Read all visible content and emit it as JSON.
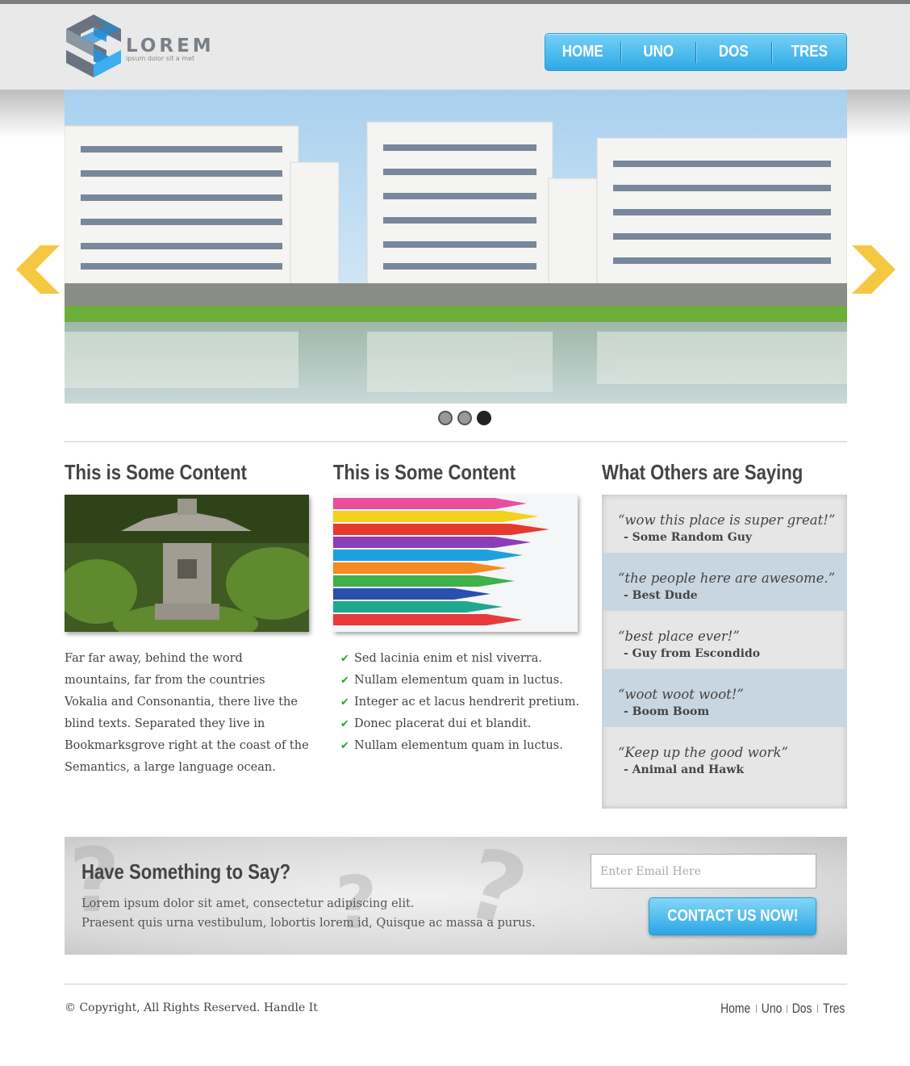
{
  "brand": {
    "name": "LOREM",
    "tagline": "ipsum dolor sit a met"
  },
  "nav": {
    "items": [
      "HOME",
      "UNO",
      "DOS",
      "TRES"
    ]
  },
  "slider": {
    "dots": 3,
    "active_dot": 3
  },
  "columns": [
    {
      "title": "This is Some Content",
      "image": "stone-lantern-photo",
      "text": "Far far away, behind the word mountains, far from the countries Vokalia and Consonantia, there live the blind texts. Separated they live in Bookmarksgrove right at the coast of the Semantics, a large language ocean."
    },
    {
      "title": "This is Some Content",
      "image": "colored-pencils-photo",
      "list": [
        "Sed lacinia enim et nisl viverra.",
        "Nullam elementum quam in luctus.",
        "Integer ac et lacus hendrerit pretium.",
        "Donec placerat dui et blandit.",
        "Nullam elementum quam in luctus."
      ]
    }
  ],
  "testimonials": {
    "title": "What Others are Saying",
    "items": [
      {
        "quote": "“wow this place is super great!”",
        "author": "- Some Random Guy"
      },
      {
        "quote": "“the people here are awesome.”",
        "author": "- Best Dude"
      },
      {
        "quote": "“best place ever!”",
        "author": "- Guy from Escondido"
      },
      {
        "quote": "“woot woot woot!”",
        "author": "- Boom Boom"
      },
      {
        "quote": "“Keep up the good work”",
        "author": "- Animal and Hawk"
      }
    ]
  },
  "cta": {
    "title": "Have Something to Say?",
    "line1": "Lorem ipsum dolor sit amet, consectetur adipiscing elit.",
    "line2": "Praesent quis urna vestibulum, lobortis lorem id, Quisque ac massa a purus.",
    "email_placeholder": "Enter Email Here",
    "button": "CONTACT US NOW!"
  },
  "footer": {
    "copyright": "© Copyright, All Rights Reserved. Handle It",
    "links": [
      "Home",
      "Uno",
      "Dos",
      "Tres"
    ]
  },
  "colors": {
    "accent": "#2da9e6",
    "arrow": "#f5c842"
  }
}
